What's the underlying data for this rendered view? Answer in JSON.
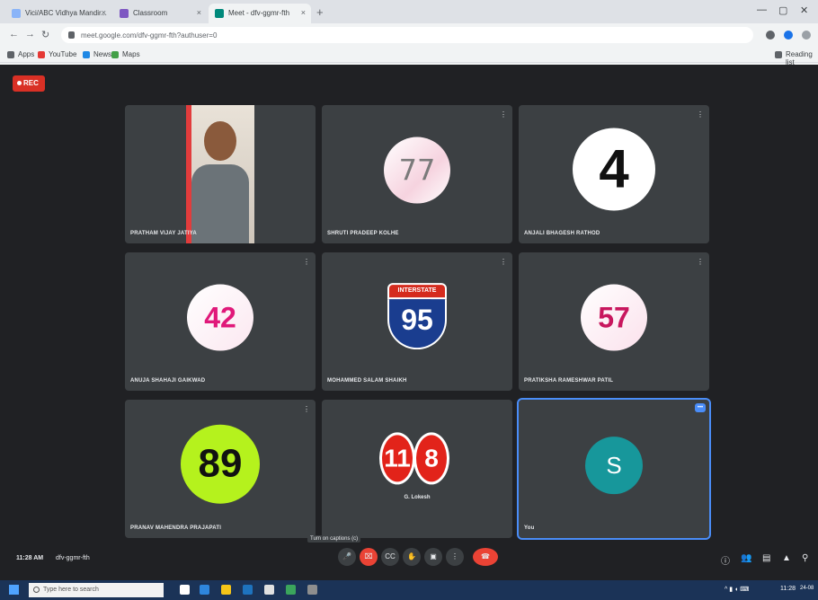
{
  "browser": {
    "tabs": [
      {
        "label": "Vici/ABC Vidhya Mandir..."
      },
      {
        "label": "Classroom"
      },
      {
        "label": "Meet - dfv-ggmr-fth"
      }
    ],
    "url": "meet.google.com/dfv-ggmr-fth?authuser=0",
    "bookmarks": [
      {
        "label": "Apps"
      },
      {
        "label": "YouTube"
      },
      {
        "label": "News"
      },
      {
        "label": "Maps"
      }
    ],
    "reading_list": "Reading list"
  },
  "meeting": {
    "rec_label": "REC",
    "participants": [
      {
        "name": "PRATHAM VIJAY JATIYA",
        "type": "video"
      },
      {
        "name": "SHRUTI PRADEEP KOLHE",
        "badge": "77"
      },
      {
        "name": "ANJALI BHAGESH RATHOD",
        "badge": "4"
      },
      {
        "name": "ANUJA SHAHAJI GAIKWAD",
        "badge": "42"
      },
      {
        "name": "MOHAMMED SALAM SHAIKH",
        "badge": "95",
        "shield_top": "INTERSTATE"
      },
      {
        "name": "PRATIKSHA RAMESHWAR PATIL",
        "badge": "57"
      },
      {
        "name": "PRANAV MAHENDRA PRAJAPATI",
        "badge": "89"
      },
      {
        "name": "",
        "badge_a": "11",
        "badge_b": "8",
        "subtitle": "G. Lokesh"
      },
      {
        "name": "You",
        "avatar": "S"
      }
    ],
    "clock": "11:28 AM",
    "meeting_code": "dfv-ggmr-fth",
    "tooltip": "Turn on captions (c)",
    "controls": [
      {
        "icon": "mic-icon",
        "glyph": "🎤"
      },
      {
        "icon": "camera-off-icon",
        "glyph": "⌧"
      },
      {
        "icon": "captions-icon",
        "glyph": "CC"
      },
      {
        "icon": "raise-hand-icon",
        "glyph": "✋"
      },
      {
        "icon": "present-icon",
        "glyph": "▣"
      },
      {
        "icon": "more-options-icon",
        "glyph": "⋮"
      },
      {
        "icon": "hang-up-icon",
        "glyph": "☎"
      }
    ],
    "right_icons": [
      {
        "icon": "info-icon",
        "glyph": "ⓘ"
      },
      {
        "icon": "people-icon",
        "glyph": "👥"
      },
      {
        "icon": "chat-icon",
        "glyph": "▤"
      },
      {
        "icon": "activities-icon",
        "glyph": "▲"
      },
      {
        "icon": "lock-icon",
        "glyph": "⚲"
      }
    ]
  },
  "taskbar": {
    "search_placeholder": "Type here to search",
    "tray_time": "11:28",
    "tray_date": "24-08"
  }
}
